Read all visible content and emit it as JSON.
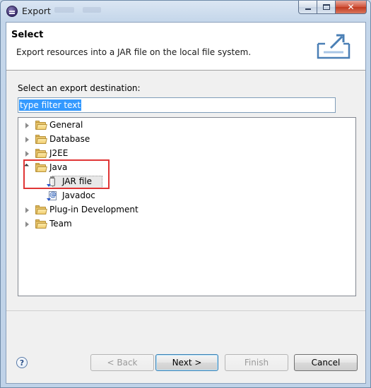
{
  "window": {
    "title": "Export"
  },
  "header": {
    "title": "Select",
    "description": "Export resources into a JAR file on the local file system."
  },
  "destination_label": "Select an export destination:",
  "filter": {
    "value": "type filter text"
  },
  "tree": {
    "items": [
      {
        "label": "General",
        "expanded": false
      },
      {
        "label": "Database",
        "expanded": false
      },
      {
        "label": "J2EE",
        "expanded": false
      },
      {
        "label": "Java",
        "expanded": true
      },
      {
        "label": "JAR file",
        "selected": true
      },
      {
        "label": "Javadoc"
      },
      {
        "label": "Plug-in Development",
        "expanded": false
      },
      {
        "label": "Team",
        "expanded": false
      }
    ]
  },
  "buttons": {
    "help": "?",
    "back": "< Back",
    "next": "Next >",
    "finish": "Finish",
    "cancel": "Cancel"
  },
  "colors": {
    "highlight_box": "#e03535",
    "selection": "#3399ff"
  }
}
